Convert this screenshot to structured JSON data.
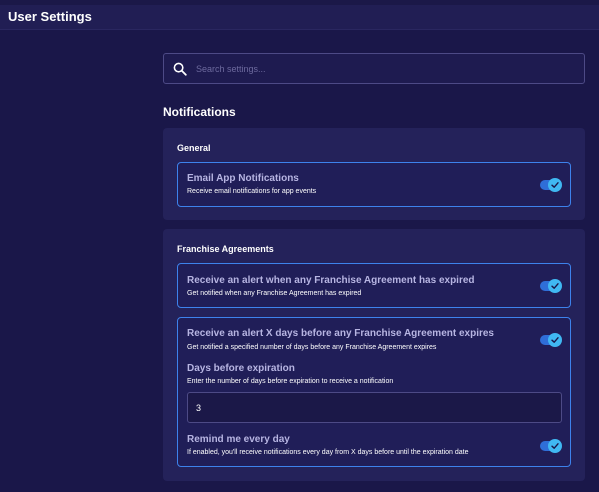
{
  "app": {
    "title": "User Settings"
  },
  "search": {
    "placeholder": "Search settings..."
  },
  "section": {
    "title": "Notifications"
  },
  "groups": [
    {
      "title": "General",
      "settings": [
        {
          "title": "Email App Notifications",
          "description": "Receive email notifications for app events",
          "enabled": true
        }
      ]
    },
    {
      "title": "Franchise Agreements",
      "settings": [
        {
          "title": "Receive an alert when any Franchise Agreement has expired",
          "description": "Get notified when any Franchise Agreement has expired",
          "enabled": true
        },
        {
          "title": "Receive an alert X days before any Franchise Agreement expires",
          "description": "Get notified a specified number of days before any Franchise Agreement expires",
          "enabled": true,
          "days": {
            "label": "Days before expiration",
            "description": "Enter the number of days before expiration to receive a notification",
            "value": "3"
          },
          "remind": {
            "label": "Remind me every day",
            "description": "If enabled, you'll receive notifications every day from X days before until the expiration date",
            "enabled": true
          }
        }
      ]
    }
  ],
  "colors": {
    "accent": "#3d82ec",
    "toggle_knob": "#40b8f2",
    "background": "#1a1749",
    "panel": "#24225a"
  },
  "icons": {
    "search": "search-icon",
    "toggle_check": "check-icon"
  }
}
